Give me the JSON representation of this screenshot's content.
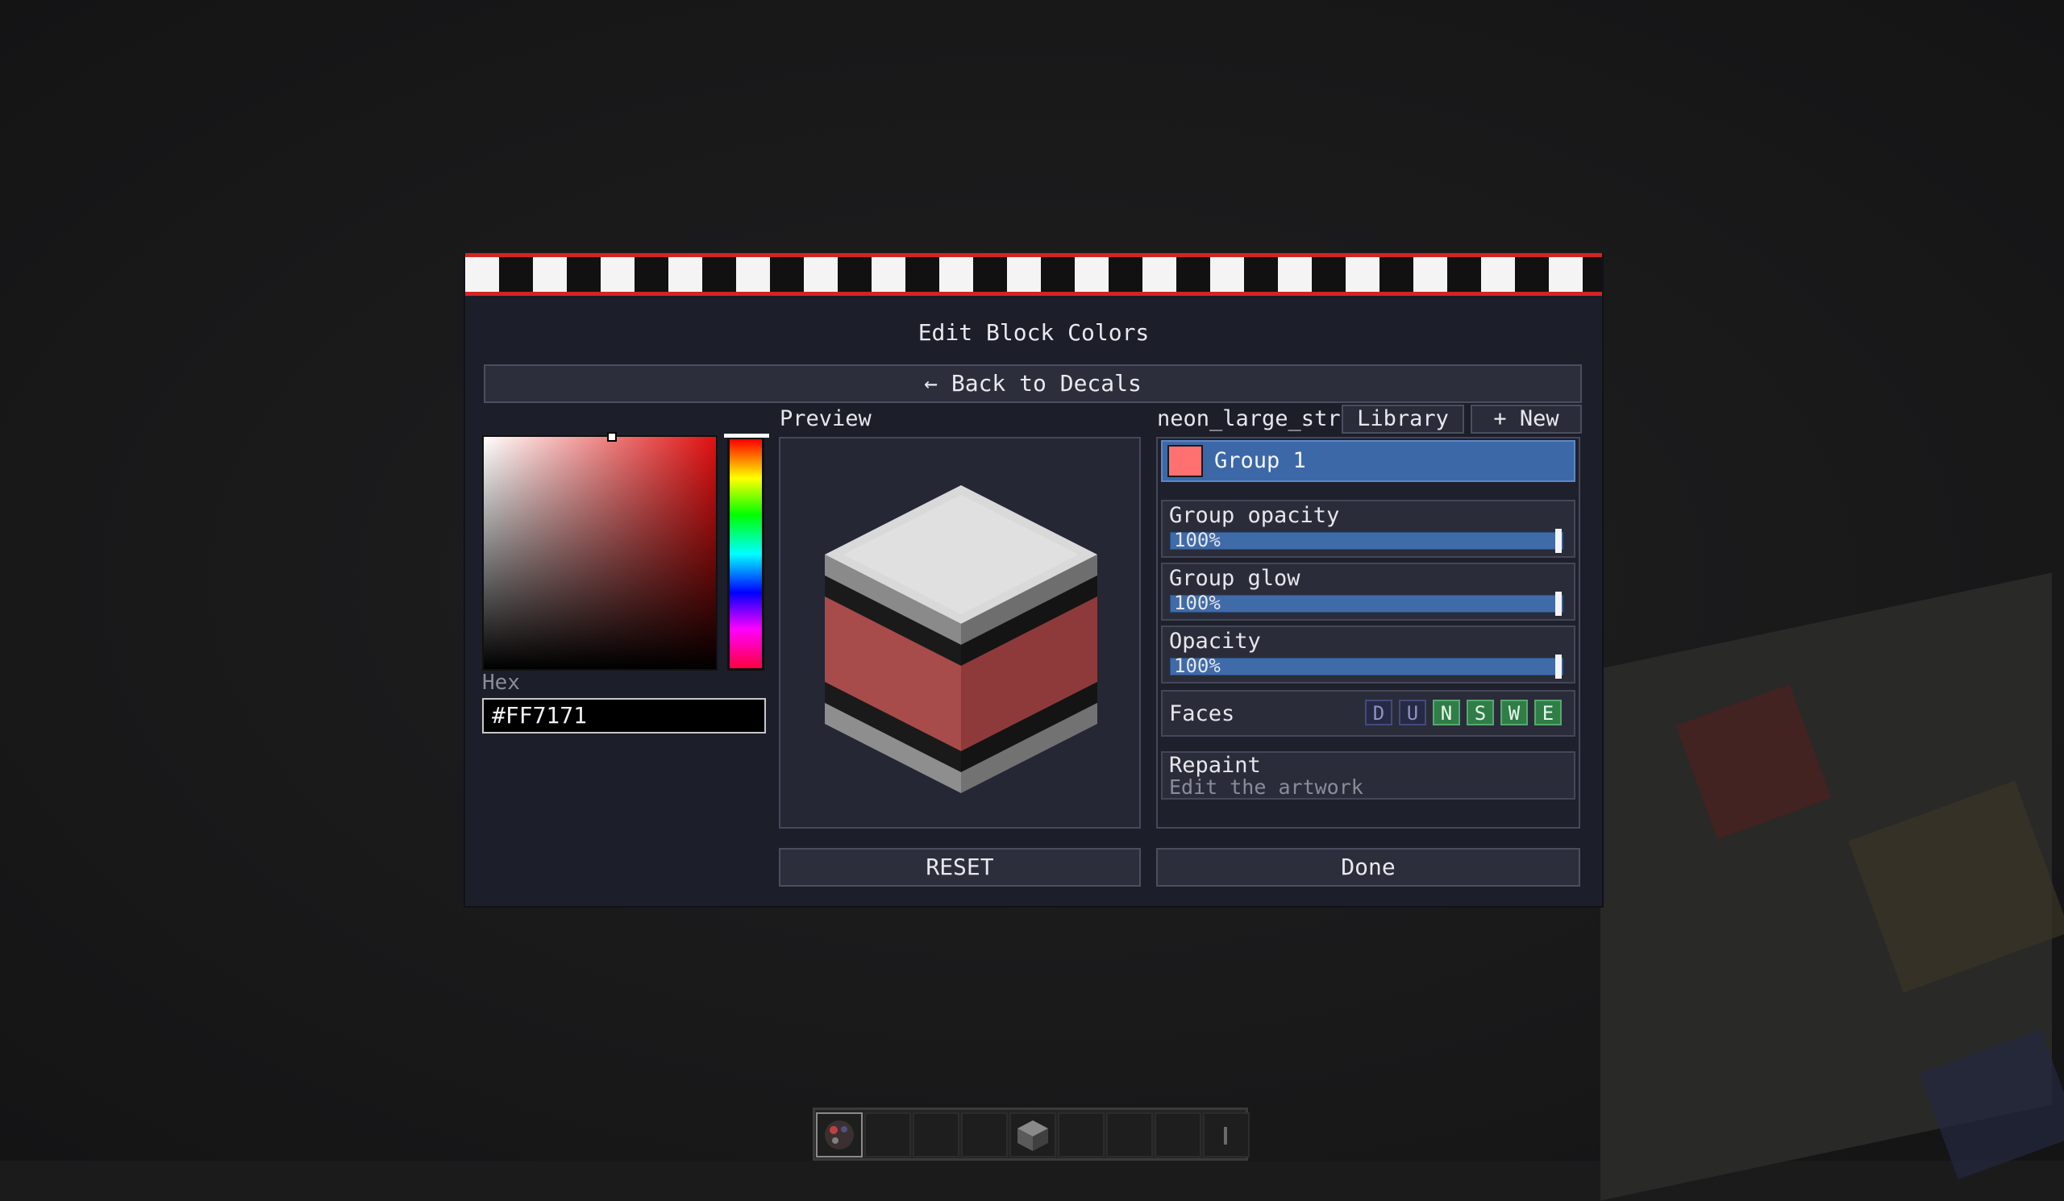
{
  "screen": {
    "title": "Edit Block Colors",
    "back_button": "← Back to Decals"
  },
  "color_picker": {
    "hex_label": "Hex",
    "hex_value": "#FF7171",
    "selected_color": "#ff7171"
  },
  "preview": {
    "label": "Preview"
  },
  "groups_panel": {
    "file_name": "neon_large_strip",
    "library_button": "Library",
    "new_button": "+ New",
    "groups": [
      {
        "name": "Group 1",
        "color": "#ff7171",
        "selected": true
      }
    ],
    "group_opacity": {
      "label": "Group opacity",
      "value_text": "100%",
      "value": 1.0
    },
    "group_glow": {
      "label": "Group glow",
      "value_text": "100%",
      "value": 1.0
    },
    "opacity": {
      "label": "Opacity",
      "value_text": "100%",
      "value": 1.0
    },
    "faces": {
      "label": "Faces",
      "items": [
        {
          "letter": "D",
          "enabled": false
        },
        {
          "letter": "U",
          "enabled": false
        },
        {
          "letter": "N",
          "enabled": true
        },
        {
          "letter": "S",
          "enabled": true
        },
        {
          "letter": "W",
          "enabled": true
        },
        {
          "letter": "E",
          "enabled": true
        }
      ]
    },
    "repaint": {
      "title": "Repaint",
      "subtitle": "Edit the artwork"
    }
  },
  "footer": {
    "reset_button": "RESET",
    "done_button": "Done"
  },
  "colors": {
    "accent_blue": "#3d68a8",
    "stripe_red": "#d32424",
    "face_enabled": "#2f7d47"
  }
}
